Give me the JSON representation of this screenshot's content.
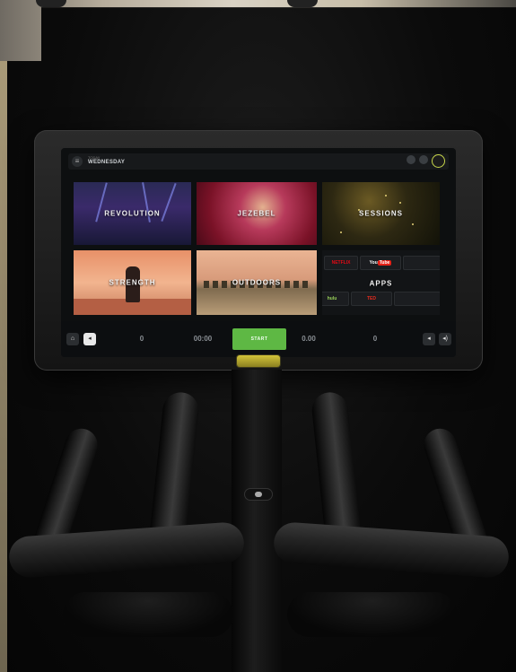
{
  "screen": {
    "header": {
      "subtitle": "TODAY",
      "day": "WEDNESDAY"
    },
    "tiles": [
      {
        "id": "revolution",
        "label": "REVOLUTION"
      },
      {
        "id": "jezebel",
        "label": "JEZEBEL"
      },
      {
        "id": "sessions",
        "label": "SESSIONS"
      },
      {
        "id": "strength",
        "label": "STRENGTH"
      },
      {
        "id": "outdoors",
        "label": "OUTDOORS"
      },
      {
        "id": "apps",
        "label": "APPS"
      }
    ],
    "apps": [
      "NETFLIX",
      "You",
      "Tube",
      "TED",
      "hulu"
    ],
    "metrics": [
      {
        "label": "",
        "value": "0"
      },
      {
        "label": "",
        "value": "00:00"
      },
      {
        "label": "",
        "value": "0.00"
      },
      {
        "label": "",
        "value": "0"
      }
    ],
    "start_label": "START"
  },
  "colors": {
    "accent_green": "#5eb844",
    "brand_yellow": "#c7d64a",
    "background": "#050505"
  },
  "icons": [
    "menu-icon",
    "notification-icon",
    "settings-icon",
    "avatar-icon",
    "home-icon",
    "volume-icon",
    "back-icon",
    "speaker-icon"
  ]
}
